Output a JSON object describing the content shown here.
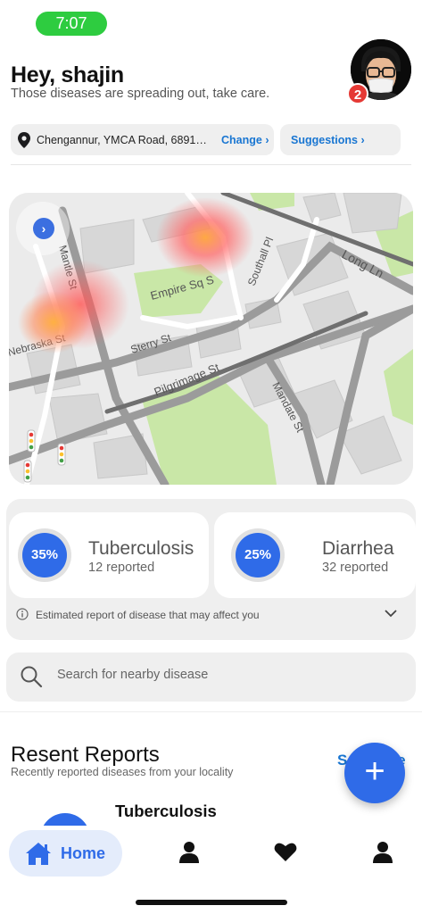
{
  "status_bar": {
    "time": "7:07"
  },
  "header": {
    "greeting": "Hey, shajin",
    "subtitle": "Those diseases are spreading out, take care.",
    "notification_count": "2"
  },
  "location": {
    "address": "Chengannur, YMCA Road, 689121, ...",
    "change_label": "Change",
    "suggestions_label": "Suggestions"
  },
  "map": {
    "street_labels": [
      "Long Ln",
      "Southall Pl",
      "Empire Sq S",
      "Nebraska St",
      "Sterry St",
      "Pilgrimage St",
      "Mandate St",
      "Mantle St"
    ]
  },
  "stats": {
    "cards": [
      {
        "percent": "35%",
        "name": "Tuberculosis",
        "count": "12 reported"
      },
      {
        "percent": "25%",
        "name": "Diarrhea",
        "count": "32 reported"
      }
    ],
    "note": "Estimated report of disease that may affect you"
  },
  "search": {
    "placeholder": "Search for nearby disease"
  },
  "reports": {
    "title": "Resent Reports",
    "subtitle": "Recently reported diseases from your locality",
    "see_more": "See more",
    "items": [
      {
        "name": "Tuberculosis"
      }
    ]
  },
  "nav": {
    "home_label": "Home"
  },
  "colors": {
    "accent": "#2f6be8",
    "link": "#1976d2",
    "status_green": "#2ecc40",
    "badge_red": "#e53935"
  }
}
